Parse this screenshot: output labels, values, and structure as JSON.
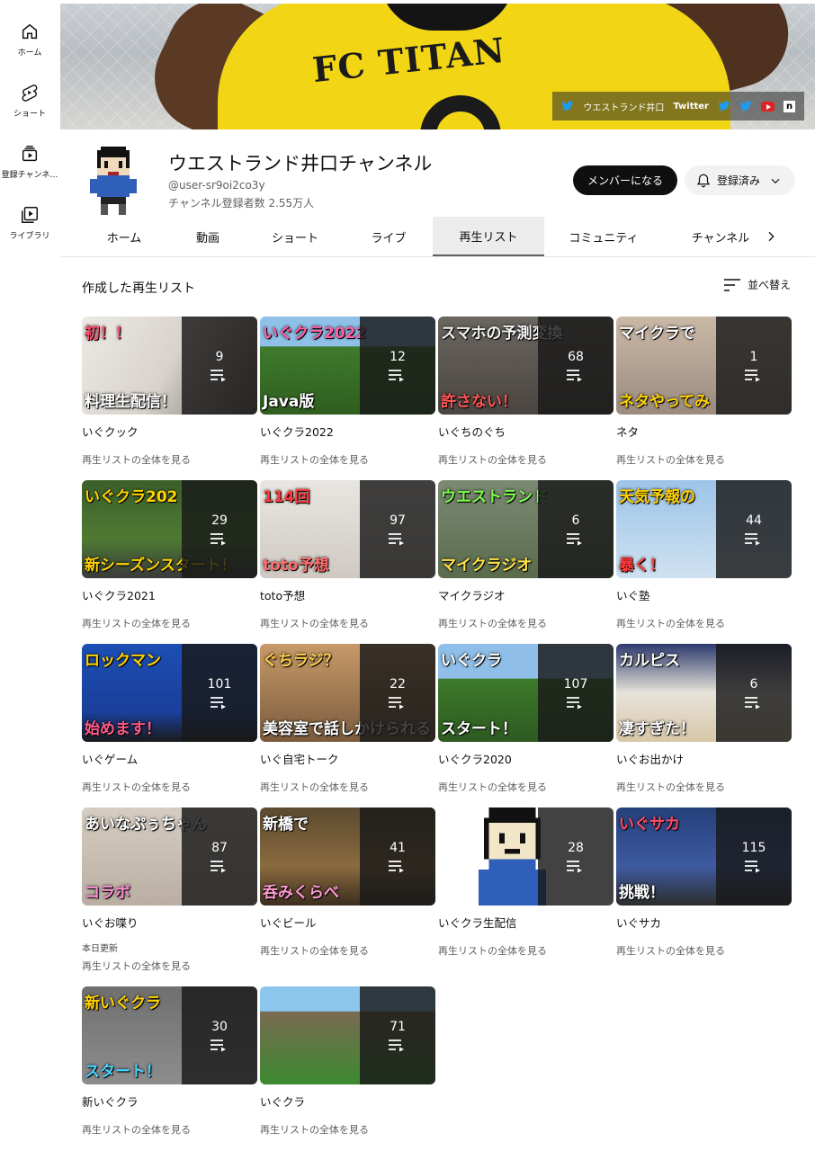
{
  "nav": [
    {
      "label": "ホーム",
      "icon": "home-icon"
    },
    {
      "label": "ショート",
      "icon": "shorts-icon"
    },
    {
      "label": "登録チャンネ…",
      "icon": "subscriptions-icon"
    },
    {
      "label": "ライブラリ",
      "icon": "library-icon"
    }
  ],
  "banner": {
    "shirt_text": "FC TITAN",
    "link_name": "ウエストランド井口",
    "link_twitter": "Twitter"
  },
  "channel": {
    "title": "ウエストランド井口チャンネル",
    "handle": "@user-sr9oi2co3y",
    "subscribers": "チャンネル登録者数 2.55万人",
    "member_button": "メンバーになる",
    "subscribed_button": "登録済み"
  },
  "tabs": [
    "ホーム",
    "動画",
    "ショート",
    "ライブ",
    "再生リスト",
    "コミュニティ",
    "チャンネル"
  ],
  "active_tab": "再生リスト",
  "section_title": "作成した再生リスト",
  "sort_label": "並べ替え",
  "view_all_label": "再生リストの全体を見る",
  "colors": {
    "accent": "#0f0f0f",
    "youtube_red": "#e02222",
    "twitter_blue": "#1d9bf0"
  },
  "playlists": [
    {
      "name": "いぐクック",
      "count": "9",
      "caption": "初！！",
      "caption2": "料理生配信！"
    },
    {
      "name": "いぐクラ2022",
      "count": "12",
      "caption": "いぐクラ2022",
      "caption2": "Java版"
    },
    {
      "name": "いぐちのぐち",
      "count": "68",
      "caption": "スマホの予測変換",
      "caption2": "許さない！"
    },
    {
      "name": "ネタ",
      "count": "1",
      "caption": "マイクラで",
      "caption2": "ネタやってみ"
    },
    {
      "name": "いぐクラ2021",
      "count": "29",
      "caption": "いぐクラ202",
      "caption2": "新シーズンスタート！"
    },
    {
      "name": "toto予想",
      "count": "97",
      "caption": "114回",
      "caption2": "toto予想"
    },
    {
      "name": "マイクラジオ",
      "count": "6",
      "caption": "ウエストランド",
      "caption2": "マイクラジオ"
    },
    {
      "name": "いぐ塾",
      "count": "44",
      "caption": "天気予報の",
      "caption2": "暴く！"
    },
    {
      "name": "いぐゲーム",
      "count": "101",
      "caption": "ロックマン",
      "caption2": "始めます！"
    },
    {
      "name": "いぐ自宅トーク",
      "count": "22",
      "caption": "ぐちラジ？",
      "caption2": "美容室で話しかけられる"
    },
    {
      "name": "いぐクラ2020",
      "count": "107",
      "caption": "いぐクラ",
      "caption2": "スタート！"
    },
    {
      "name": "いぐお出かけ",
      "count": "6",
      "caption": "カルピス",
      "caption2": "凄すぎた！"
    },
    {
      "name": "いぐお喋り",
      "count": "87",
      "caption": "あいなぷぅちゃん",
      "caption2": "コラボ",
      "updated": "本日更新"
    },
    {
      "name": "いぐビール",
      "count": "41",
      "caption": "新橋で",
      "caption2": "呑みくらべ"
    },
    {
      "name": "いぐクラ生配信",
      "count": "28",
      "caption": "",
      "caption2": ""
    },
    {
      "name": "いぐサカ",
      "count": "115",
      "caption": "いぐサカ",
      "caption2": "挑戦！"
    },
    {
      "name": "新いぐクラ",
      "count": "30",
      "caption": "新いぐクラ",
      "caption2": "スタート！"
    },
    {
      "name": "いぐクラ",
      "count": "71",
      "caption": "",
      "caption2": ""
    }
  ]
}
